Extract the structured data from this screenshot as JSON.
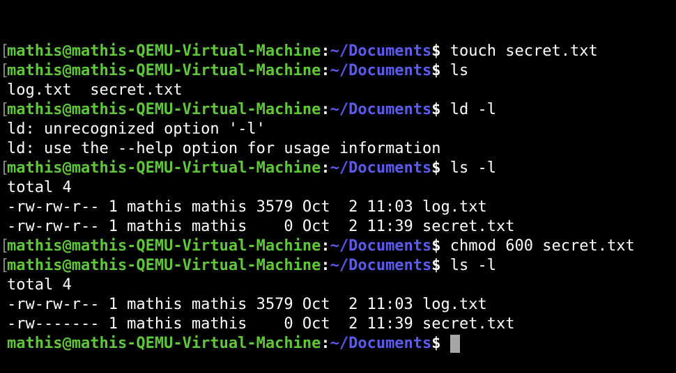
{
  "terminal": {
    "colors": {
      "background": "#000000",
      "user_host": "#5fc83a",
      "path": "#5b5bf0",
      "text": "#ffffff",
      "cursor": "#a7a7a7"
    },
    "prompt": {
      "bracket": "[",
      "user_host": "mathis@mathis-QEMU-Virtual-Machine",
      "colon": ":",
      "path": "~/Documents",
      "dollar": "$ "
    },
    "lines": [
      {
        "type": "prompt",
        "bracket": true,
        "command": "touch secret.txt"
      },
      {
        "type": "prompt",
        "bracket": true,
        "command": "ls"
      },
      {
        "type": "output",
        "text": "log.txt  secret.txt"
      },
      {
        "type": "prompt",
        "bracket": true,
        "command": "ld -l"
      },
      {
        "type": "output",
        "text": "ld: unrecognized option '-l'"
      },
      {
        "type": "output",
        "text": "ld: use the --help option for usage information"
      },
      {
        "type": "prompt",
        "bracket": true,
        "command": "ls -l"
      },
      {
        "type": "output",
        "text": "total 4"
      },
      {
        "type": "output",
        "text": "-rw-rw-r-- 1 mathis mathis 3579 Oct  2 11:03 log.txt"
      },
      {
        "type": "output",
        "text": "-rw-rw-r-- 1 mathis mathis    0 Oct  2 11:39 secret.txt"
      },
      {
        "type": "prompt",
        "bracket": true,
        "command": "chmod 600 secret.txt"
      },
      {
        "type": "prompt",
        "bracket": true,
        "command": "ls -l"
      },
      {
        "type": "output",
        "text": "total 4"
      },
      {
        "type": "output",
        "text": "-rw-rw-r-- 1 mathis mathis 3579 Oct  2 11:03 log.txt"
      },
      {
        "type": "output",
        "text": "-rw------- 1 mathis mathis    0 Oct  2 11:39 secret.txt"
      },
      {
        "type": "prompt",
        "bracket": false,
        "command": "",
        "cursor": true
      }
    ]
  }
}
